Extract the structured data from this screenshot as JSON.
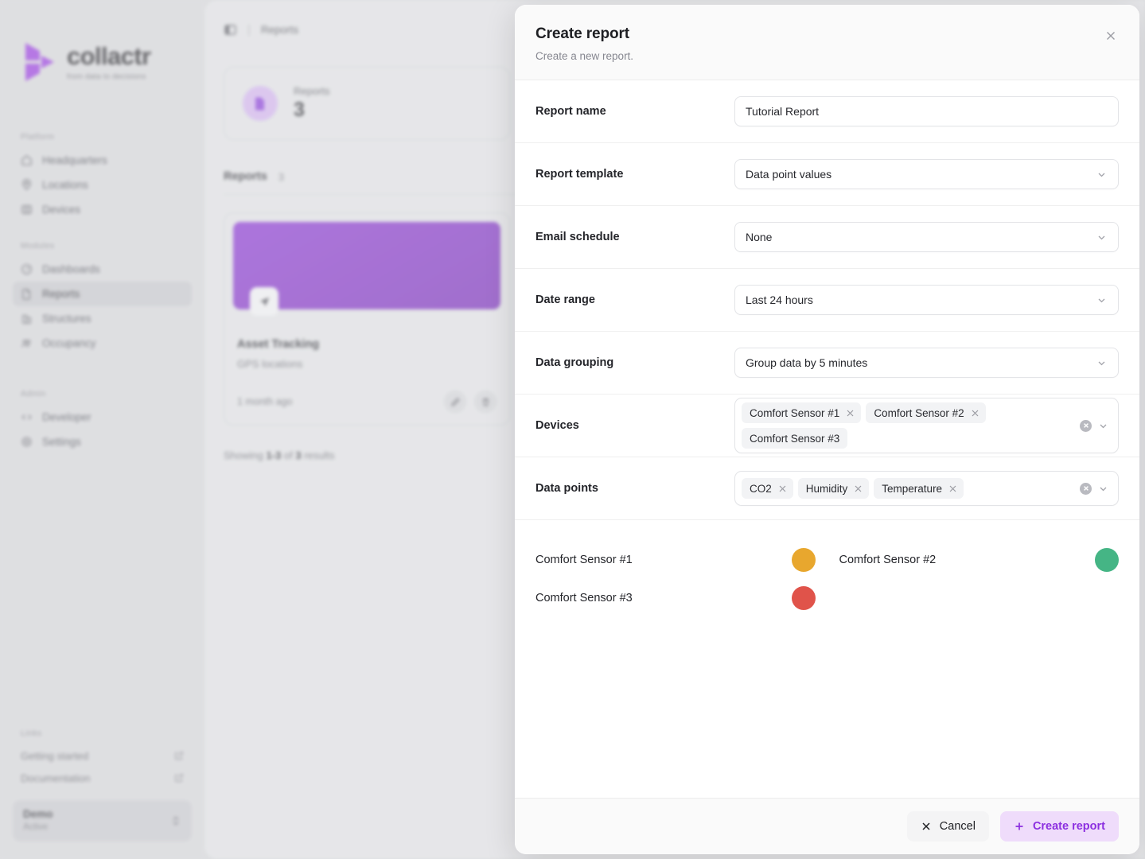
{
  "brand": {
    "name": "collactr",
    "tagline": "from data to decisions"
  },
  "sidebar": {
    "groups": [
      {
        "heading": "Platform",
        "items": [
          {
            "label": "Headquarters",
            "icon": "home-icon",
            "active": false
          },
          {
            "label": "Locations",
            "icon": "map-pin-icon",
            "active": false
          },
          {
            "label": "Devices",
            "icon": "devices-icon",
            "active": false
          }
        ]
      },
      {
        "heading": "Modules",
        "items": [
          {
            "label": "Dashboards",
            "icon": "gauge-icon",
            "active": false
          },
          {
            "label": "Reports",
            "icon": "document-icon",
            "active": true
          },
          {
            "label": "Structures",
            "icon": "building-icon",
            "active": false
          },
          {
            "label": "Occupancy",
            "icon": "people-icon",
            "active": false
          }
        ]
      },
      {
        "heading": "Admin",
        "items": [
          {
            "label": "Developer",
            "icon": "code-icon",
            "active": false
          },
          {
            "label": "Settings",
            "icon": "gear-icon",
            "active": false
          }
        ]
      }
    ],
    "links_heading": "Links",
    "links": [
      {
        "label": "Getting started",
        "icon": "external-link-icon"
      },
      {
        "label": "Documentation",
        "icon": "external-link-icon"
      }
    ],
    "org": {
      "name": "Demo",
      "status": "Active",
      "icon": "chevron-up-down-icon"
    }
  },
  "topbar": {
    "panel_icon": "panel-toggle-icon",
    "separator": "|",
    "breadcrumb": "Reports"
  },
  "stat_card": {
    "icon": "document-icon",
    "label": "Reports",
    "value": "3"
  },
  "list_header": {
    "title": "Reports",
    "count": "3"
  },
  "report_card": {
    "badge_icon": "navigation-icon",
    "title": "Asset Tracking",
    "subtitle": "GPS locations",
    "time": "1 month ago",
    "edit_icon": "edit-icon",
    "delete_icon": "trash-icon"
  },
  "showing": {
    "prefix": "Showing ",
    "range": "1-3",
    "middle": " of ",
    "total": "3",
    "suffix": " results"
  },
  "modal": {
    "title": "Create report",
    "subtitle": "Create a new report.",
    "close_icon": "close-icon",
    "fields": {
      "report_name": {
        "label": "Report name",
        "value": "Tutorial Report",
        "placeholder": "Report name"
      },
      "report_template": {
        "label": "Report template",
        "value": "Data point values",
        "icon": "chevron-down-icon"
      },
      "email_schedule": {
        "label": "Email schedule",
        "value": "None",
        "icon": "chevron-down-icon"
      },
      "date_range": {
        "label": "Date range",
        "value": "Last 24 hours",
        "icon": "chevron-down-icon"
      },
      "data_grouping": {
        "label": "Data grouping",
        "value": "Group data by 5 minutes",
        "icon": "chevron-down-icon"
      },
      "devices": {
        "label": "Devices",
        "chips": [
          {
            "label": "Comfort Sensor #1",
            "removable": true
          },
          {
            "label": "Comfort Sensor #2",
            "removable": true
          },
          {
            "label": "Comfort Sensor #3",
            "removable": false
          }
        ],
        "clear_icon": "clear-circle-icon",
        "icon": "chevron-down-icon"
      },
      "data_points": {
        "label": "Data points",
        "chips": [
          {
            "label": "CO2",
            "removable": true
          },
          {
            "label": "Humidity",
            "removable": true
          },
          {
            "label": "Temperature",
            "removable": true
          }
        ],
        "clear_icon": "clear-circle-icon",
        "icon": "chevron-down-icon"
      }
    },
    "device_colors": [
      {
        "name": "Comfort Sensor #1",
        "color": "#E8A72E"
      },
      {
        "name": "Comfort Sensor #2",
        "color": "#45B585"
      },
      {
        "name": "Comfort Sensor #3",
        "color": "#E0534A"
      }
    ],
    "footer": {
      "cancel_label": "Cancel",
      "cancel_icon": "close-icon",
      "create_label": "Create report",
      "create_icon": "plus-icon"
    }
  },
  "colors": {
    "brand_purple": "#8D39D4",
    "primary_button_bg": "#EFDCFB",
    "primary_button_text": "#8C2FE0"
  }
}
